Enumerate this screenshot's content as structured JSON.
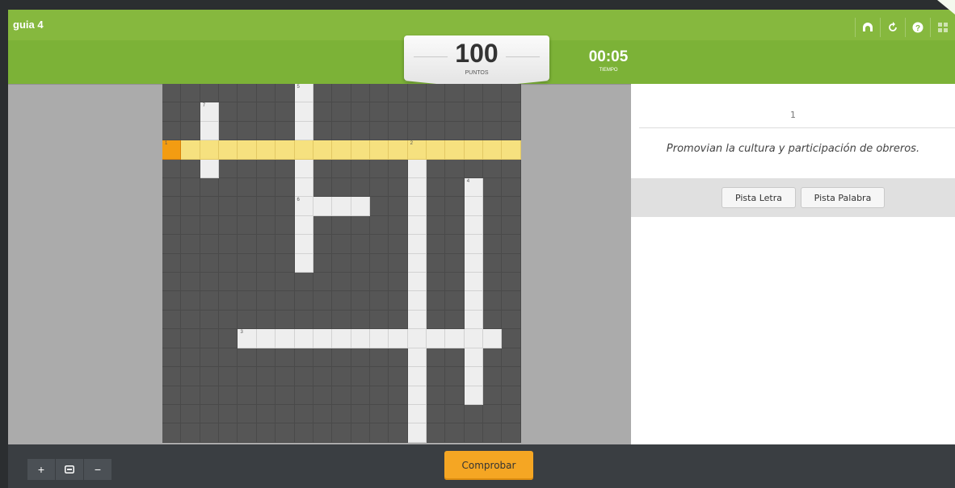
{
  "game": {
    "title": "guia 4",
    "score": {
      "value": "100",
      "label": "PUNTOS"
    },
    "timer": {
      "value": "00:05",
      "label": "TIEMPO"
    }
  },
  "toolbar": {
    "icons": [
      "fullscreen-icon",
      "restart-icon",
      "help-icon",
      "menu-grid-icon"
    ]
  },
  "crossword": {
    "rows": 19,
    "cols": 19,
    "white_cells": [
      [
        0,
        7
      ],
      [
        1,
        2
      ],
      [
        1,
        7
      ],
      [
        2,
        2
      ],
      [
        2,
        7
      ],
      [
        4,
        2
      ],
      [
        4,
        7
      ],
      [
        4,
        13
      ],
      [
        5,
        7
      ],
      [
        5,
        13
      ],
      [
        5,
        16
      ],
      [
        6,
        7
      ],
      [
        6,
        8
      ],
      [
        6,
        9
      ],
      [
        6,
        10
      ],
      [
        6,
        13
      ],
      [
        6,
        16
      ],
      [
        7,
        7
      ],
      [
        7,
        13
      ],
      [
        7,
        16
      ],
      [
        8,
        7
      ],
      [
        8,
        13
      ],
      [
        8,
        16
      ],
      [
        9,
        7
      ],
      [
        9,
        13
      ],
      [
        9,
        16
      ],
      [
        10,
        13
      ],
      [
        10,
        16
      ],
      [
        11,
        13
      ],
      [
        11,
        16
      ],
      [
        12,
        13
      ],
      [
        12,
        16
      ],
      [
        13,
        4
      ],
      [
        13,
        5
      ],
      [
        13,
        6
      ],
      [
        13,
        7
      ],
      [
        13,
        8
      ],
      [
        13,
        9
      ],
      [
        13,
        10
      ],
      [
        13,
        11
      ],
      [
        13,
        12
      ],
      [
        13,
        13
      ],
      [
        13,
        14
      ],
      [
        13,
        15
      ],
      [
        13,
        16
      ],
      [
        13,
        17
      ],
      [
        14,
        13
      ],
      [
        14,
        16
      ],
      [
        15,
        13
      ],
      [
        15,
        16
      ],
      [
        16,
        13
      ],
      [
        16,
        16
      ],
      [
        17,
        13
      ],
      [
        18,
        13
      ]
    ],
    "highlighted_row": 3,
    "active_cell": [
      3,
      0
    ],
    "numbers": [
      {
        "row": 0,
        "col": 7,
        "n": "5"
      },
      {
        "row": 1,
        "col": 2,
        "n": "7"
      },
      {
        "row": 3,
        "col": 0,
        "n": "1"
      },
      {
        "row": 3,
        "col": 13,
        "n": "2"
      },
      {
        "row": 5,
        "col": 16,
        "n": "4"
      },
      {
        "row": 6,
        "col": 7,
        "n": "6"
      },
      {
        "row": 13,
        "col": 4,
        "n": "3"
      }
    ]
  },
  "clue": {
    "number": "1",
    "text": "Promovian la cultura y participación de obreros."
  },
  "hints": {
    "letter": "Pista Letra",
    "word": "Pista Palabra"
  },
  "zoom": {
    "in": "+",
    "fit": "⊟",
    "out": "−"
  },
  "check_button": "Comprobar",
  "colors": {
    "green": "#86b83e",
    "highlight": "#f6e17f",
    "active": "#f39c12",
    "button": "#f5a623"
  }
}
